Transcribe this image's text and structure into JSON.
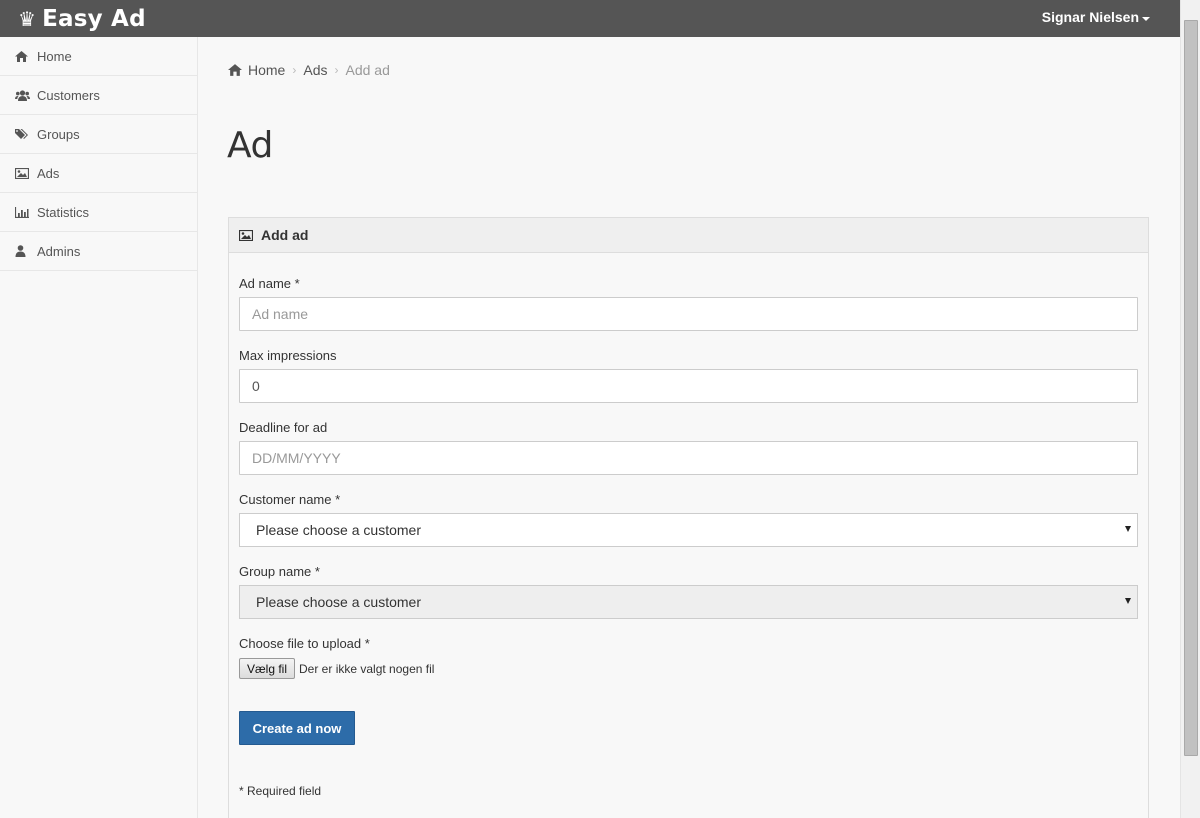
{
  "app": {
    "brand": "Easy Ad",
    "user_name": "Signar Nielsen"
  },
  "sidebar": {
    "items": [
      {
        "label": "Home",
        "icon": "home-icon"
      },
      {
        "label": "Customers",
        "icon": "users-icon"
      },
      {
        "label": "Groups",
        "icon": "tags-icon"
      },
      {
        "label": "Ads",
        "icon": "picture-icon"
      },
      {
        "label": "Statistics",
        "icon": "bar-chart-icon"
      },
      {
        "label": "Admins",
        "icon": "user-icon"
      }
    ]
  },
  "breadcrumb": {
    "items": [
      "Home",
      "Ads",
      "Add ad"
    ]
  },
  "page": {
    "title": "Ad"
  },
  "panel": {
    "title": "Add ad"
  },
  "form": {
    "ad_name": {
      "label": "Ad name *",
      "placeholder": "Ad name",
      "value": ""
    },
    "max_impressions": {
      "label": "Max impressions",
      "value": "0"
    },
    "deadline": {
      "label": "Deadline for ad",
      "placeholder": "DD/MM/YYYY",
      "value": ""
    },
    "customer": {
      "label": "Customer name *",
      "selected": "Please choose a customer"
    },
    "group": {
      "label": "Group name *",
      "selected": "Please choose a customer"
    },
    "file": {
      "label": "Choose file to upload *",
      "button": "Vælg fil",
      "status": "Der er ikke valgt nogen fil"
    },
    "submit": "Create ad now",
    "required_note": "* Required field"
  },
  "colors": {
    "topbar": "#555555",
    "primary_button": "#2d6ca9",
    "background": "#f8f8f8"
  }
}
